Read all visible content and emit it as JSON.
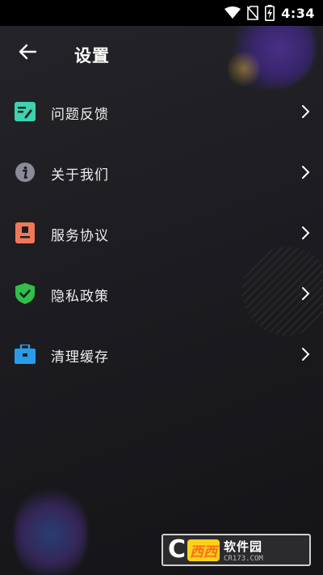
{
  "status_bar": {
    "time": "4:34",
    "icons": [
      "wifi-icon",
      "no-sim-icon",
      "battery-charging-icon"
    ]
  },
  "header": {
    "back_icon": "arrow-left-icon",
    "title": "设置"
  },
  "settings": {
    "items": [
      {
        "label": "问题反馈",
        "icon": "feedback-icon",
        "color": "#3fd1b0"
      },
      {
        "label": "关于我们",
        "icon": "info-icon",
        "color": "#8a8a99"
      },
      {
        "label": "服务协议",
        "icon": "agreement-icon",
        "color": "#f0785a"
      },
      {
        "label": "隐私政策",
        "icon": "shield-check-icon",
        "color": "#2fbf4a"
      },
      {
        "label": "清理缓存",
        "icon": "briefcase-icon",
        "color": "#2a9be8"
      }
    ],
    "chevron_icon": "chevron-right-icon"
  },
  "watermark": {
    "letter": "C",
    "brand_cn": "西西",
    "soft": "软件园",
    "url": "CR173.COM"
  }
}
